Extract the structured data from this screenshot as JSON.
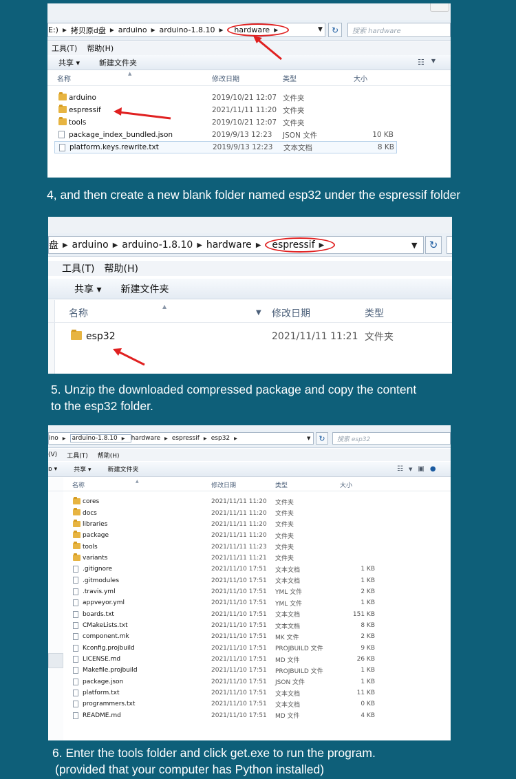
{
  "colors": {
    "background": "#0e5f79",
    "highlight": "#e02020",
    "folder": "#e7b441"
  },
  "shot1": {
    "breadcrumb": [
      "E:)",
      "拷贝原d盘",
      "arduino",
      "arduino-1.8.10",
      "hardware"
    ],
    "search_placeholder": "搜索 hardware",
    "menu": [
      "工具(T)",
      "帮助(H)"
    ],
    "toolbar": {
      "share": "共享 ▾",
      "new_folder": "新建文件夹"
    },
    "columns": [
      "名称",
      "修改日期",
      "类型",
      "大小"
    ],
    "rows": [
      {
        "name": "arduino",
        "date": "2019/10/21 12:07",
        "type": "文件夹",
        "size": "",
        "icon": "folder-icon"
      },
      {
        "name": "espressif",
        "date": "2021/11/11 11:20",
        "type": "文件夹",
        "size": "",
        "icon": "folder-icon"
      },
      {
        "name": "tools",
        "date": "2019/10/21 12:07",
        "type": "文件夹",
        "size": "",
        "icon": "folder-icon"
      },
      {
        "name": "package_index_bundled.json",
        "date": "2019/9/13 12:23",
        "type": "JSON 文件",
        "size": "10 KB",
        "icon": "file-icon"
      },
      {
        "name": "platform.keys.rewrite.txt",
        "date": "2019/9/13 12:23",
        "type": "文本文档",
        "size": "8 KB",
        "icon": "file-icon"
      }
    ]
  },
  "caption1": "4, and then create a new blank folder named esp32 under the espressif folder",
  "shot2": {
    "breadcrumb": [
      "盘",
      "arduino",
      "arduino-1.8.10",
      "hardware",
      "espressif"
    ],
    "menu": [
      "工具(T)",
      "帮助(H)"
    ],
    "toolbar": {
      "share": "共享 ▾",
      "new_folder": "新建文件夹"
    },
    "columns": [
      "名称",
      "修改日期",
      "类型"
    ],
    "rows": [
      {
        "name": "esp32",
        "date": "2021/11/11 11:21",
        "type": "文件夹",
        "icon": "folder-icon"
      }
    ]
  },
  "caption2": [
    "5. Unzip the downloaded compressed package and copy the content",
    "to the esp32 folder."
  ],
  "shot3": {
    "breadcrumb": [
      "ino",
      "arduino-1.8.10",
      "hardware",
      "espressif",
      "esp32"
    ],
    "search_placeholder": "搜索 esp32",
    "menu": [
      "(V)",
      "工具(T)",
      "帮助(H)"
    ],
    "toolbar": {
      "left": "ɒ ▾",
      "share": "共享 ▾",
      "new_folder": "新建文件夹"
    },
    "columns": [
      "名称",
      "修改日期",
      "类型",
      "大小"
    ],
    "rows": [
      {
        "name": "cores",
        "date": "2021/11/11 11:20",
        "type": "文件夹",
        "size": "",
        "icon": "folder-icon"
      },
      {
        "name": "docs",
        "date": "2021/11/11 11:20",
        "type": "文件夹",
        "size": "",
        "icon": "folder-icon"
      },
      {
        "name": "libraries",
        "date": "2021/11/11 11:20",
        "type": "文件夹",
        "size": "",
        "icon": "folder-icon"
      },
      {
        "name": "package",
        "date": "2021/11/11 11:20",
        "type": "文件夹",
        "size": "",
        "icon": "folder-icon"
      },
      {
        "name": "tools",
        "date": "2021/11/11 11:23",
        "type": "文件夹",
        "size": "",
        "icon": "folder-icon"
      },
      {
        "name": "variants",
        "date": "2021/11/11 11:21",
        "type": "文件夹",
        "size": "",
        "icon": "folder-icon"
      },
      {
        "name": ".gitignore",
        "date": "2021/11/10 17:51",
        "type": "文本文档",
        "size": "1 KB",
        "icon": "file-icon"
      },
      {
        "name": ".gitmodules",
        "date": "2021/11/10 17:51",
        "type": "文本文档",
        "size": "1 KB",
        "icon": "file-icon"
      },
      {
        "name": ".travis.yml",
        "date": "2021/11/10 17:51",
        "type": "YML 文件",
        "size": "2 KB",
        "icon": "file-icon"
      },
      {
        "name": "appveyor.yml",
        "date": "2021/11/10 17:51",
        "type": "YML 文件",
        "size": "1 KB",
        "icon": "file-icon"
      },
      {
        "name": "boards.txt",
        "date": "2021/11/10 17:51",
        "type": "文本文档",
        "size": "151 KB",
        "icon": "file-icon"
      },
      {
        "name": "CMakeLists.txt",
        "date": "2021/11/10 17:51",
        "type": "文本文档",
        "size": "8 KB",
        "icon": "file-icon"
      },
      {
        "name": "component.mk",
        "date": "2021/11/10 17:51",
        "type": "MK 文件",
        "size": "2 KB",
        "icon": "file-icon"
      },
      {
        "name": "Kconfig.projbuild",
        "date": "2021/11/10 17:51",
        "type": "PROJBUILD 文件",
        "size": "9 KB",
        "icon": "file-icon"
      },
      {
        "name": "LICENSE.md",
        "date": "2021/11/10 17:51",
        "type": "MD 文件",
        "size": "26 KB",
        "icon": "file-icon"
      },
      {
        "name": "Makefile.projbuild",
        "date": "2021/11/10 17:51",
        "type": "PROJBUILD 文件",
        "size": "1 KB",
        "icon": "file-icon"
      },
      {
        "name": "package.json",
        "date": "2021/11/10 17:51",
        "type": "JSON 文件",
        "size": "1 KB",
        "icon": "file-icon"
      },
      {
        "name": "platform.txt",
        "date": "2021/11/10 17:51",
        "type": "文本文档",
        "size": "11 KB",
        "icon": "file-icon"
      },
      {
        "name": "programmers.txt",
        "date": "2021/11/10 17:51",
        "type": "文本文档",
        "size": "0 KB",
        "icon": "file-icon"
      },
      {
        "name": "README.md",
        "date": "2021/11/10 17:51",
        "type": "MD 文件",
        "size": "4 KB",
        "icon": "file-icon"
      }
    ]
  },
  "caption3": [
    "6. Enter the tools folder and click get.exe to run the program.",
    "(provided that your computer has Python installed)"
  ]
}
